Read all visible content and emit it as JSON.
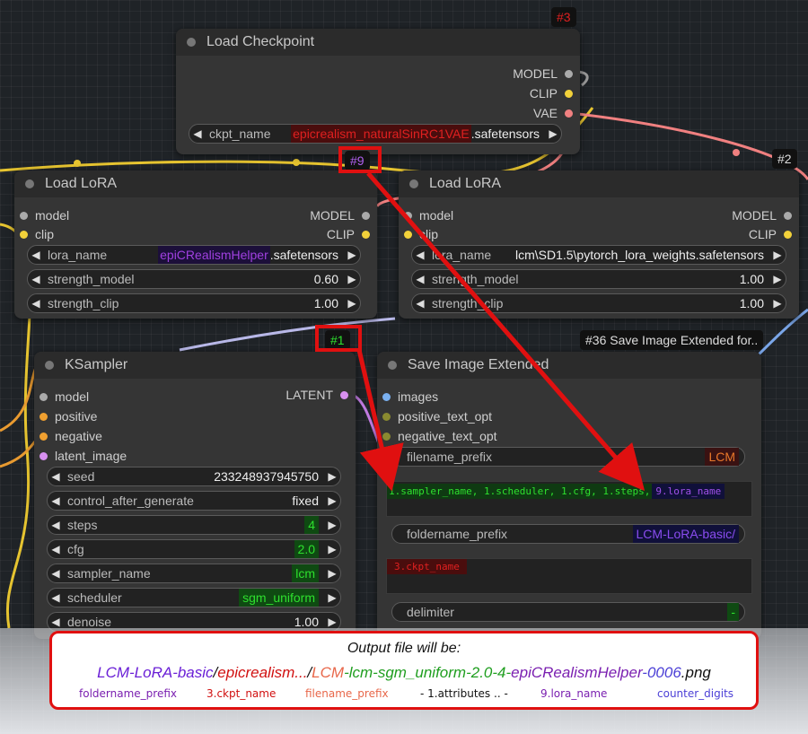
{
  "badges": {
    "n3": "#3",
    "n2": "#2",
    "n36": "#36 Save Image Extended for..",
    "n9": "#9",
    "n1": "#1"
  },
  "checkpoint": {
    "title": "Load Checkpoint",
    "outputs": [
      "MODEL",
      "CLIP",
      "VAE"
    ],
    "ckpt_label": "ckpt_name",
    "ckpt_highlight": "epicrealism_naturalSinRC1VAE",
    "ckpt_suffix": ".safetensors"
  },
  "lora1": {
    "title": "Load LoRA",
    "inputs": [
      "model",
      "clip"
    ],
    "outputs": [
      "MODEL",
      "CLIP"
    ],
    "lora_label": "lora_name",
    "lora_highlight": "epiCRealismHelper",
    "lora_suffix": ".safetensors",
    "strength_model_label": "strength_model",
    "strength_model": "0.60",
    "strength_clip_label": "strength_clip",
    "strength_clip": "1.00"
  },
  "lora2": {
    "title": "Load LoRA",
    "inputs": [
      "model",
      "clip"
    ],
    "outputs": [
      "MODEL",
      "CLIP"
    ],
    "lora_label": "lora_name",
    "lora_value": "lcm\\SD1.5\\pytorch_lora_weights.safetensors",
    "strength_model_label": "strength_model",
    "strength_model": "1.00",
    "strength_clip_label": "strength_clip",
    "strength_clip": "1.00"
  },
  "ksampler": {
    "title": "KSampler",
    "inputs": [
      "model",
      "positive",
      "negative",
      "latent_image"
    ],
    "output": "LATENT",
    "seed_label": "seed",
    "seed": "233248937945750",
    "cag_label": "control_after_generate",
    "cag": "fixed",
    "steps_label": "steps",
    "steps": "4",
    "cfg_label": "cfg",
    "cfg": "2.0",
    "sampler_label": "sampler_name",
    "sampler": "lcm",
    "scheduler_label": "scheduler",
    "scheduler": "sgm_uniform",
    "denoise_label": "denoise",
    "denoise": "1.00"
  },
  "save": {
    "title": "Save Image Extended",
    "inputs": [
      "images",
      "positive_text_opt",
      "negative_text_opt"
    ],
    "filename_prefix_label": "filename_prefix",
    "filename_prefix": "LCM",
    "attr_text": "1.sampler_name, 1.scheduler, 1.cfg, 1.steps,",
    "attr_lora": "9.lora_name",
    "foldername_prefix_label": "foldername_prefix",
    "foldername_prefix": "LCM-LoRA-basic/",
    "folder_text": "3.ckpt_name",
    "delimiter_label": "delimiter",
    "delimiter": "-"
  },
  "callout": {
    "title": "Output file will be:",
    "path": [
      {
        "t": "LCM-LoRA-basic",
        "c": "#6a1fd6"
      },
      {
        "t": "/",
        "c": "#111111"
      },
      {
        "t": "epicrealism...",
        "c": "#d11010"
      },
      {
        "t": "/",
        "c": "#111111"
      },
      {
        "t": "LCM",
        "c": "#e8674a"
      },
      {
        "t": "-lcm-sgm_uniform-2.0-4-",
        "c": "#1f9e1f"
      },
      {
        "t": "epiCRealismHelper",
        "c": "#7a1fb0"
      },
      {
        "t": "-0006",
        "c": "#4b3fd6"
      },
      {
        "t": ".png",
        "c": "#111111"
      }
    ],
    "legend": [
      {
        "t": "foldername_prefix",
        "c": "#7a1fb0"
      },
      {
        "t": "3.ckpt_name",
        "c": "#d11010"
      },
      {
        "t": "filename_prefix",
        "c": "#e8674a"
      },
      {
        "t": "- 1.attributes .. -",
        "c": "#111111"
      },
      {
        "t": "9.lora_name",
        "c": "#7a1fb0"
      },
      {
        "t": "counter_digits",
        "c": "#4b3fd6"
      }
    ]
  }
}
